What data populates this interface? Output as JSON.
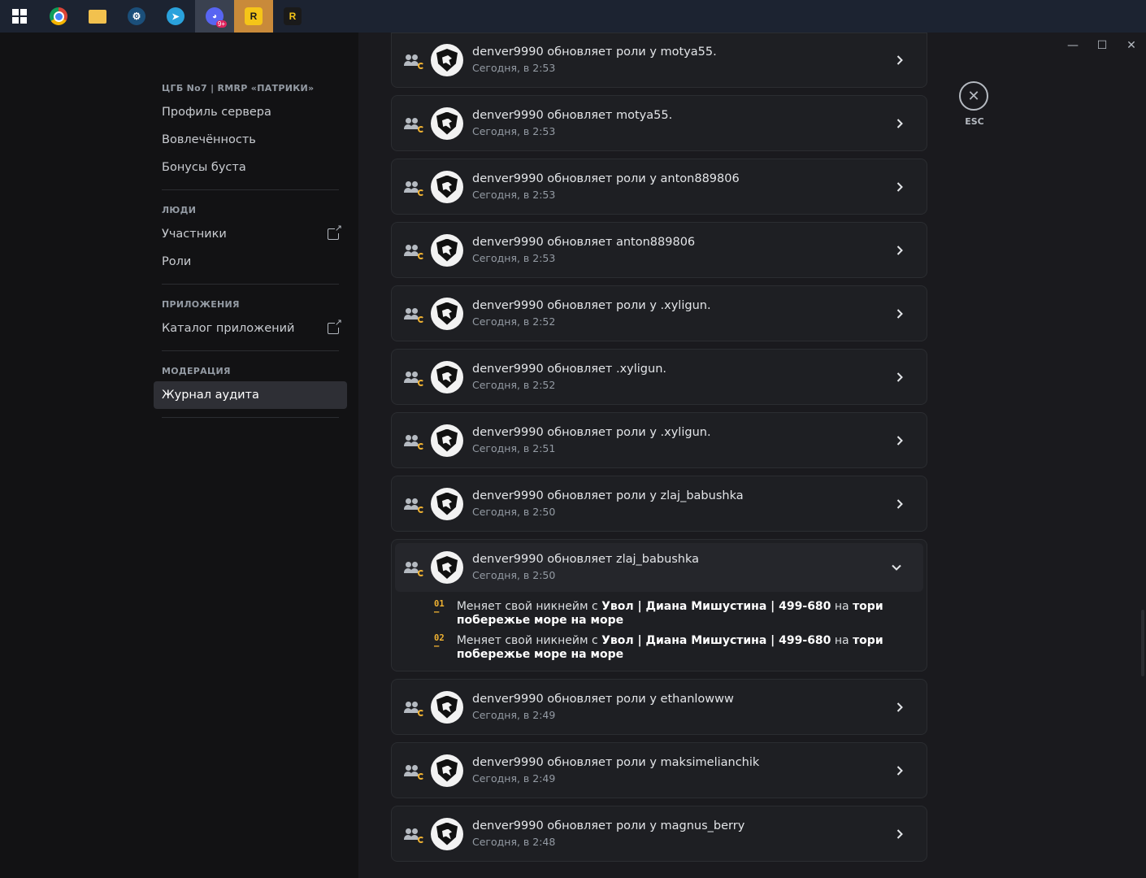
{
  "taskbar": {
    "apps": [
      {
        "name": "windows-start-icon",
        "glyph": ""
      },
      {
        "name": "chrome-icon",
        "glyph": ""
      },
      {
        "name": "file-explorer-icon",
        "glyph": ""
      },
      {
        "name": "steam-icon",
        "glyph": "⚙"
      },
      {
        "name": "telegram-icon",
        "glyph": "➤"
      },
      {
        "name": "discord-icon",
        "glyph": "◕"
      },
      {
        "name": "rockstar-icon",
        "glyph": "R"
      },
      {
        "name": "ragemp-icon",
        "glyph": "R"
      }
    ],
    "discord_badge": "9+"
  },
  "window_controls": {
    "minimize": "—",
    "maximize": "☐",
    "close": "✕"
  },
  "sidebar": {
    "server_header": "ЦГБ No7 | RMRP «ПАТРИКИ»",
    "server_items": [
      "Профиль сервера",
      "Вовлечённость",
      "Бонусы буста"
    ],
    "people_header": "ЛЮДИ",
    "people_items": [
      "Участники",
      "Роли"
    ],
    "apps_header": "ПРИЛОЖЕНИЯ",
    "apps_items": [
      "Каталог приложений"
    ],
    "moderation_header": "МОДЕРАЦИЯ",
    "moderation_items": [
      "Журнал аудита"
    ]
  },
  "esc": {
    "label": "ESC",
    "icon": "✕"
  },
  "audit_log": {
    "entries": [
      {
        "text": "denver9990 обновляет роли у motya55.",
        "time": "Сегодня, в 2:53"
      },
      {
        "text": "denver9990 обновляет motya55.",
        "time": "Сегодня, в 2:53"
      },
      {
        "text": "denver9990 обновляет роли у anton889806",
        "time": "Сегодня, в 2:53"
      },
      {
        "text": "denver9990 обновляет anton889806",
        "time": "Сегодня, в 2:53"
      },
      {
        "text": "denver9990 обновляет роли у .xyligun.",
        "time": "Сегодня, в 2:52"
      },
      {
        "text": "denver9990 обновляет .xyligun.",
        "time": "Сегодня, в 2:52"
      },
      {
        "text": "denver9990 обновляет роли у .xyligun.",
        "time": "Сегодня, в 2:51"
      },
      {
        "text": "denver9990 обновляет роли у zlaj_babushka",
        "time": "Сегодня, в 2:50"
      },
      {
        "text": "denver9990 обновляет zlaj_babushka",
        "time": "Сегодня, в 2:50"
      },
      {
        "text": "denver9990 обновляет роли у ethanlowww",
        "time": "Сегодня, в 2:49"
      },
      {
        "text": "denver9990 обновляет роли у maksimelianchik",
        "time": "Сегодня, в 2:49"
      },
      {
        "text": "denver9990 обновляет роли у magnus_berry",
        "time": "Сегодня, в 2:48"
      }
    ],
    "expanded_changes": [
      {
        "num": "01",
        "dash": "–",
        "prefix": "Меняет свой никнейм с ",
        "old": "Увол | Диана Мишустина | 499-680",
        "mid": " на ",
        "new": "тори побережье море на море"
      },
      {
        "num": "02",
        "dash": "–",
        "prefix": "Меняет свой никнейм с ",
        "old": "Увол | Диана Мишустина | 499-680",
        "mid": " на ",
        "new": "тори побережье море на море"
      }
    ]
  }
}
